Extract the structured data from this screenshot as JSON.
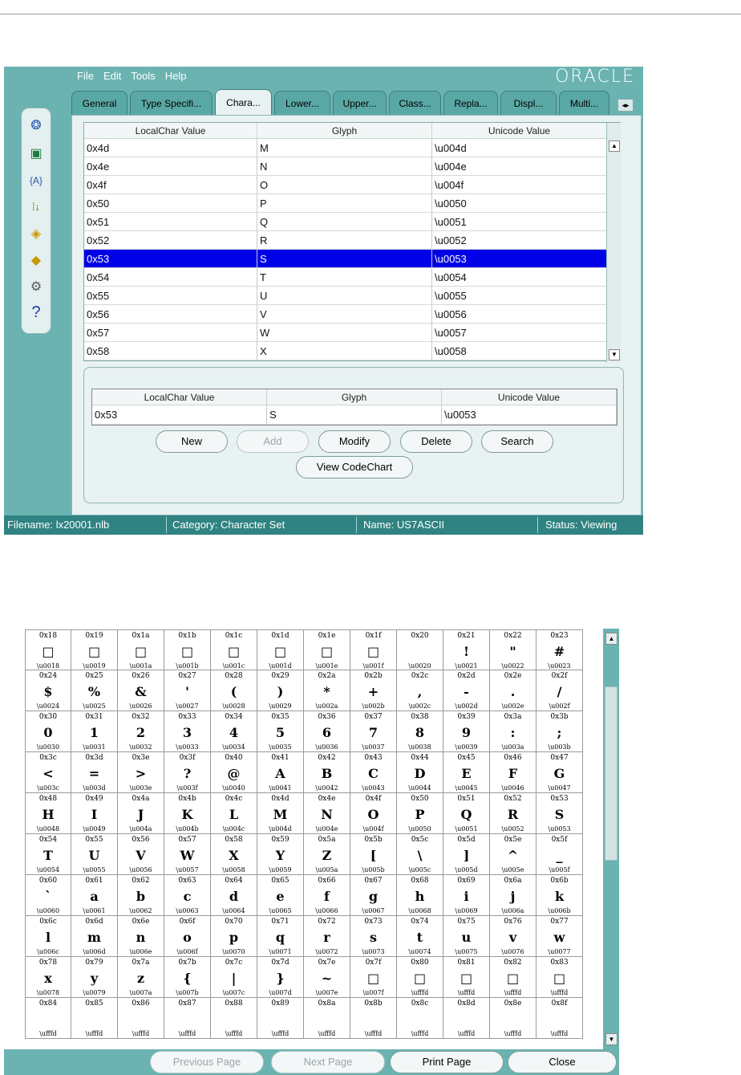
{
  "menu": [
    "File",
    "Edit",
    "Tools",
    "Help"
  ],
  "brand": "ORACLE",
  "tabs": [
    "General",
    "Type Specifi...",
    "Chara...",
    "Lower...",
    "Upper...",
    "Class...",
    "Repla...",
    "Displ...",
    "Multi..."
  ],
  "active_tab": 2,
  "toolbar_icons": [
    "user-info-icon",
    "export-icon",
    "variable-icon",
    "sort-icon",
    "open-icon",
    "edit-icon",
    "settings-icon",
    "help-icon"
  ],
  "table": {
    "headers": [
      "LocalChar Value",
      "Glyph",
      "Unicode Value"
    ],
    "rows": [
      [
        "0x4d",
        "M",
        "\\u004d"
      ],
      [
        "0x4e",
        "N",
        "\\u004e"
      ],
      [
        "0x4f",
        "O",
        "\\u004f"
      ],
      [
        "0x50",
        "P",
        "\\u0050"
      ],
      [
        "0x51",
        "Q",
        "\\u0051"
      ],
      [
        "0x52",
        "R",
        "\\u0052"
      ],
      [
        "0x53",
        "S",
        "\\u0053"
      ],
      [
        "0x54",
        "T",
        "\\u0054"
      ],
      [
        "0x55",
        "U",
        "\\u0055"
      ],
      [
        "0x56",
        "V",
        "\\u0056"
      ],
      [
        "0x57",
        "W",
        "\\u0057"
      ],
      [
        "0x58",
        "X",
        "\\u0058"
      ]
    ],
    "selected_row": 6
  },
  "edit": {
    "headers": [
      "LocalChar Value",
      "Glyph",
      "Unicode Value"
    ],
    "values": [
      "0x53",
      "S",
      "\\u0053"
    ],
    "buttons": {
      "new": "New",
      "add": "Add",
      "modify": "Modify",
      "delete": "Delete",
      "search": "Search",
      "view_codechart": "View CodeChart"
    }
  },
  "status": {
    "filename": "Filename: lx20001.nlb",
    "category": "Category: Character Set",
    "name": "Name: US7ASCII",
    "state": "Status: Viewing"
  },
  "codechart": {
    "start": 24,
    "columns": 12,
    "rows": 10,
    "glyphs": [
      "□",
      "□",
      "□",
      "□",
      "□",
      "□",
      "□",
      "□",
      "",
      "!",
      "\"",
      "#",
      "$",
      "%",
      "&",
      "'",
      "(",
      ")",
      "*",
      "+",
      ",",
      "-",
      ".",
      "/",
      "0",
      "1",
      "2",
      "3",
      "4",
      "5",
      "6",
      "7",
      "8",
      "9",
      ":",
      ";",
      "<",
      "=",
      ">",
      "?",
      "@",
      "A",
      "B",
      "C",
      "D",
      "E",
      "F",
      "G",
      "H",
      "I",
      "J",
      "K",
      "L",
      "M",
      "N",
      "O",
      "P",
      "Q",
      "R",
      "S",
      "T",
      "U",
      "V",
      "W",
      "X",
      "Y",
      "Z",
      "[",
      "\\",
      "]",
      "^",
      "_",
      "`",
      "a",
      "b",
      "c",
      "d",
      "e",
      "f",
      "g",
      "h",
      "i",
      "j",
      "k",
      "l",
      "m",
      "n",
      "o",
      "p",
      "q",
      "r",
      "s",
      "t",
      "u",
      "v",
      "w",
      "x",
      "y",
      "z",
      "{",
      "|",
      "}",
      "~",
      "□",
      "□",
      "□",
      "□",
      "□"
    ],
    "replacement_label": "\\ufffd",
    "buttons": {
      "previous": "Previous Page",
      "next": "Next Page",
      "print": "Print Page",
      "close": "Close"
    }
  }
}
